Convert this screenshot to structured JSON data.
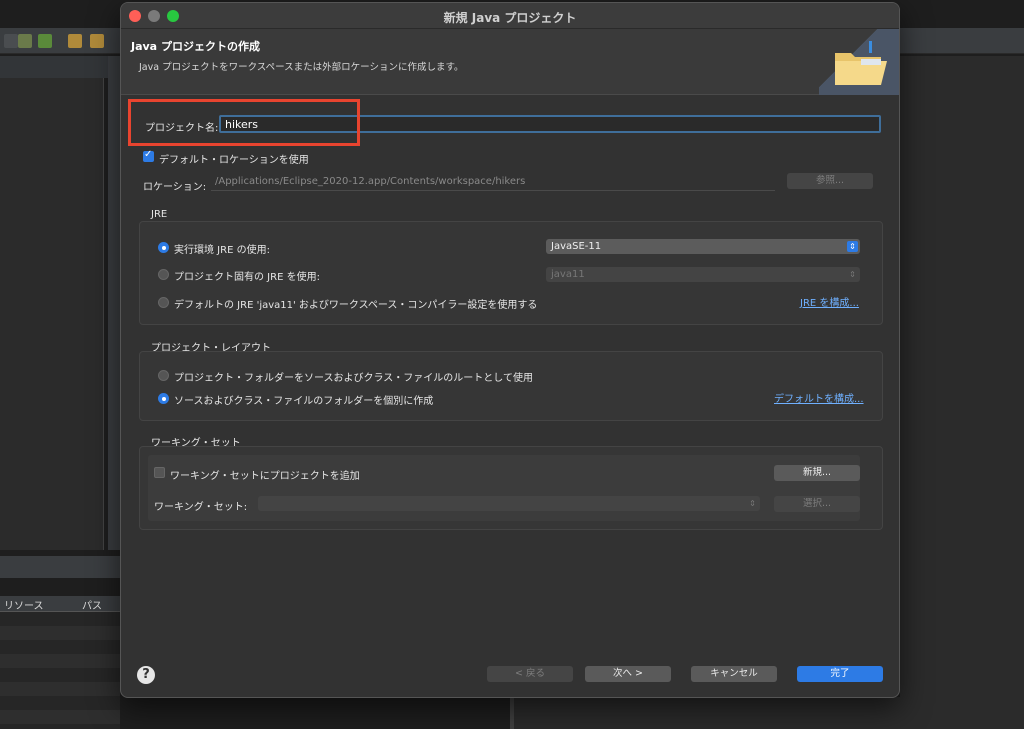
{
  "background": {
    "table_headers": [
      "リソース",
      "パス"
    ]
  },
  "dialog": {
    "title": "新規 Java プロジェクト",
    "banner": {
      "heading": "Java プロジェクトの作成",
      "description": "Java プロジェクトをワークスペースまたは外部ロケーションに作成します。",
      "icon": "folder-icon"
    },
    "project_name": {
      "label": "プロジェクト名:",
      "value": "hikers"
    },
    "default_location": {
      "label": "デフォルト・ロケーションを使用",
      "checked": true
    },
    "location": {
      "label": "ロケーション:",
      "value": "/Applications/Eclipse_2020-12.app/Contents/workspace/hikers",
      "browse_label": "参照..."
    },
    "jre": {
      "title": "JRE",
      "option_env_label": "実行環境 JRE の使用:",
      "option_env_value": "JavaSE-11",
      "option_project_label": "プロジェクト固有の JRE を使用:",
      "option_project_value": "java11",
      "option_default_label": "デフォルトの JRE 'java11' およびワークスペース・コンパイラー設定を使用する",
      "configure_link": "JRE を構成..."
    },
    "layout": {
      "title": "プロジェクト・レイアウト",
      "option_root_label": "プロジェクト・フォルダーをソースおよびクラス・ファイルのルートとして使用",
      "option_separate_label": "ソースおよびクラス・ファイルのフォルダーを個別に作成",
      "configure_link": "デフォルトを構成..."
    },
    "working_sets": {
      "title": "ワーキング・セット",
      "add_label": "ワーキング・セットにプロジェクトを追加",
      "new_button": "新規...",
      "sets_label": "ワーキング・セット:",
      "select_button": "選択..."
    },
    "buttons": {
      "back": "< 戻る",
      "next": "次へ >",
      "cancel": "キャンセル",
      "finish": "完了"
    },
    "colors": {
      "accent": "#2d7be5",
      "highlight_box": "#e8442f",
      "link": "#6fb0ff"
    }
  }
}
